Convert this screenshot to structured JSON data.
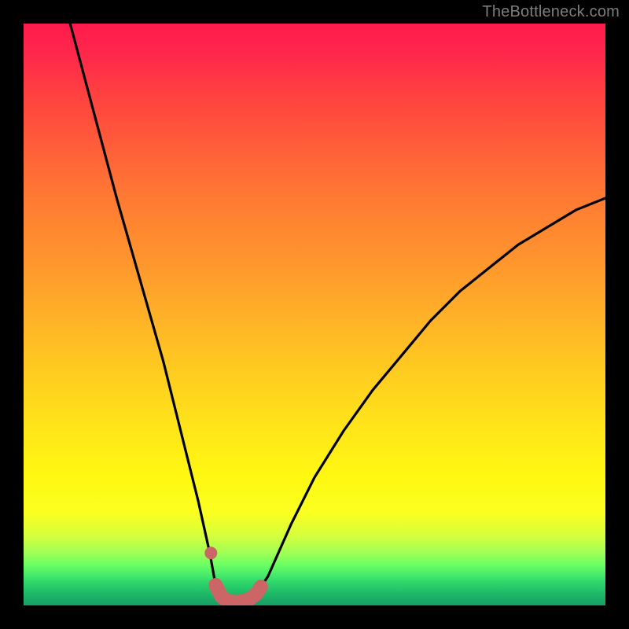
{
  "watermark": {
    "text": "TheBottleneck.com"
  },
  "colors": {
    "page_bg": "#000000",
    "curve_stroke": "#000000",
    "marker_fill": "#cc6666",
    "gradient_top": "#ff1a4d",
    "gradient_bottom": "#17a065"
  },
  "chart_data": {
    "type": "line",
    "title": "",
    "xlabel": "",
    "ylabel": "",
    "xlim": [
      0,
      100
    ],
    "ylim": [
      0,
      100
    ],
    "grid": false,
    "legend": false,
    "note": "Axis values are normalized percentages inferred from the watermark-only bottleneck chart. The curve depicts bottleneck percentage (y) vs. a component scale (x). The trough near x≈33–40 is the optimal pairing (≈0% bottleneck).",
    "series": [
      {
        "name": "bottleneck-curve",
        "x": [
          8,
          12,
          16,
          20,
          24,
          28,
          30,
          32,
          33,
          34,
          35,
          36,
          37,
          38,
          39,
          40,
          42,
          46,
          50,
          55,
          60,
          65,
          70,
          75,
          80,
          85,
          90,
          95,
          100
        ],
        "y": [
          100,
          85,
          70,
          56,
          42,
          26,
          18,
          9,
          3.5,
          1.5,
          0.8,
          0.6,
          0.6,
          0.8,
          1.2,
          2.0,
          5,
          14,
          22,
          30,
          37,
          43,
          49,
          54,
          58,
          62,
          65,
          68,
          70
        ]
      }
    ],
    "markers": {
      "name": "trough-highlight",
      "note": "Flat trough segment rendered as thick salmon stroke plus one detached dot slightly above on the left wall.",
      "dot": {
        "x": 32.2,
        "y": 9.0
      },
      "segment_x": [
        33,
        34,
        35,
        36,
        37,
        38,
        39,
        40,
        40.8
      ],
      "segment_y": [
        3.5,
        1.5,
        0.8,
        0.6,
        0.6,
        0.8,
        1.2,
        2.0,
        3.2
      ]
    }
  }
}
